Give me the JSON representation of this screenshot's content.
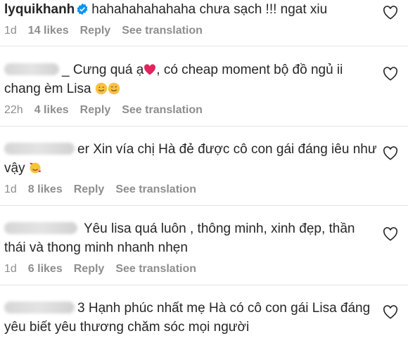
{
  "comments": [
    {
      "username": "lyquikhanh",
      "text": "hahahahahahaha chưa sạch !!! ngat xiu",
      "time": "1d",
      "likes": "14 likes",
      "reply": "Reply",
      "translate": "See translation"
    },
    {
      "username_suffix": "_",
      "text": "Cưng quá ạ",
      "text2": ", có cheap moment bộ đồ ngủ ii chang èm Lisa",
      "time": "22h",
      "likes": "4 likes",
      "reply": "Reply",
      "translate": "See translation"
    },
    {
      "username_suffix": "er",
      "text": "Xin vía chị Hà đẻ được cô con gái đáng iêu như vậy",
      "time": "1d",
      "likes": "8 likes",
      "reply": "Reply",
      "translate": "See translation"
    },
    {
      "text": "Yêu lisa quá luôn , thông minh, xinh đẹp, thần thái và thong minh nhanh nhẹn",
      "time": "1d",
      "likes": "6 likes",
      "reply": "Reply",
      "translate": "See translation"
    },
    {
      "username_suffix": "3",
      "text": "Hạnh phúc nhất mẹ Hà có cô con gái Lisa đáng yêu biết yêu thương chăm sóc mọi người"
    }
  ],
  "colors": {
    "text": "#262626",
    "meta": "#8e8e8e",
    "verified": "#0095f6",
    "heart_emoji": "#e0245e"
  }
}
